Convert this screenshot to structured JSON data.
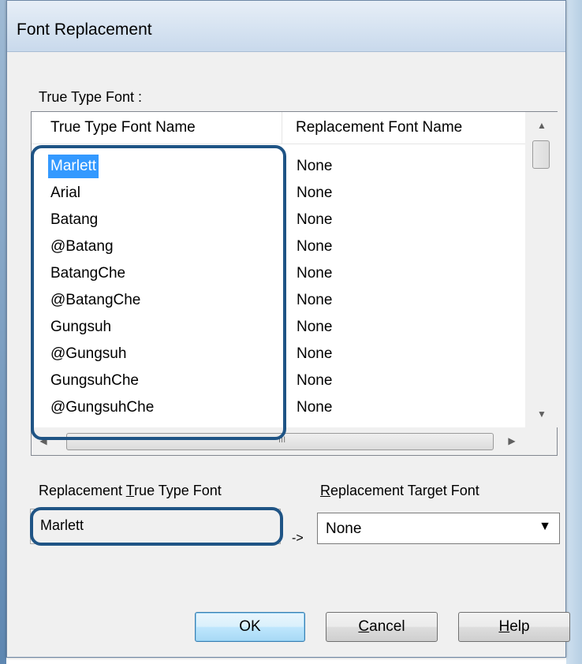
{
  "window": {
    "title": "Font Replacement"
  },
  "true_type_font": {
    "group_label": "True Type Font :",
    "columns": [
      "True Type Font Name",
      "Replacement Font Name"
    ],
    "rows": [
      {
        "name": "Marlett",
        "replacement": "None"
      },
      {
        "name": "Arial",
        "replacement": "None"
      },
      {
        "name": "Batang",
        "replacement": "None"
      },
      {
        "name": "@Batang",
        "replacement": "None"
      },
      {
        "name": "BatangChe",
        "replacement": "None"
      },
      {
        "name": "@BatangChe",
        "replacement": "None"
      },
      {
        "name": "Gungsuh",
        "replacement": "None"
      },
      {
        "name": "@Gungsuh",
        "replacement": "None"
      },
      {
        "name": "GungsuhChe",
        "replacement": "None"
      },
      {
        "name": "@GungsuhChe",
        "replacement": "None"
      }
    ],
    "selected_row": "Marlett",
    "scroll_grip": "III"
  },
  "replacement": {
    "true_type_label_pre": "Replacement ",
    "true_type_label_key": "T",
    "true_type_label_post": "rue Type Font",
    "true_type_value": "Marlett",
    "arrow": "->",
    "target_label_key": "R",
    "target_label_post": "eplacement Target Font",
    "target_value": "None"
  },
  "buttons": {
    "ok": "OK",
    "cancel_key": "C",
    "cancel_post": "ancel",
    "help_key": "H",
    "help_post": "elp"
  },
  "colors": {
    "selection": "#3399ff",
    "highlight_outline": "#1f5485",
    "default_button": "#bee6fd"
  }
}
